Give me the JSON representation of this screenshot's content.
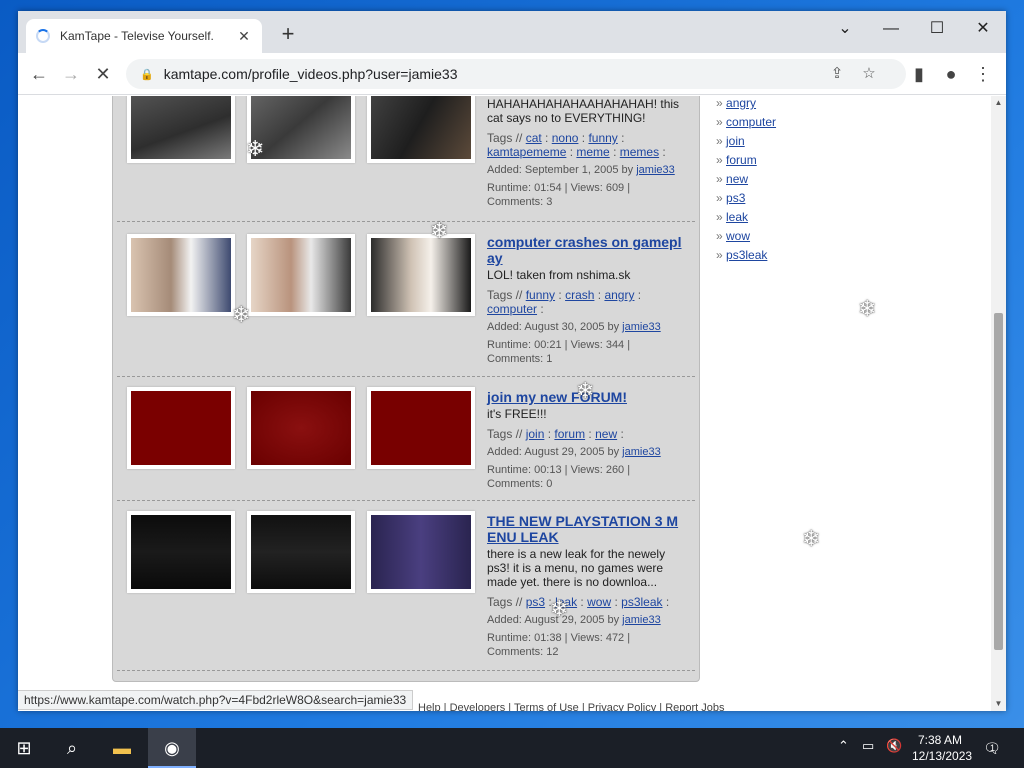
{
  "browser": {
    "tab_title": "KamTape - Televise Yourself.",
    "url": "kamtape.com/profile_videos.php?user=jamie33",
    "status_url": "https://www.kamtape.com/watch.php?v=4Fbd2rleW8O&search=jamie33"
  },
  "videos": [
    {
      "title": "",
      "desc": "HAHAHAHAHAHAAHAHAHAH! this cat says no to EVERYTHING!",
      "tags_label": "Tags //",
      "tags": [
        "cat",
        "nono",
        "funny",
        "kamtapememe",
        "meme",
        "memes"
      ],
      "added": "Added: September 1, 2005 by",
      "user": "jamie33",
      "stats": "Runtime: 01:54 | Views: 609 | Comments: 3"
    },
    {
      "title": "computer crashes on gameplay",
      "desc": "LOL! taken from nshima.sk",
      "tags_label": "Tags //",
      "tags": [
        "funny",
        "crash",
        "angry",
        "computer"
      ],
      "added": "Added: August 30, 2005 by",
      "user": "jamie33",
      "stats": "Runtime: 00:21 | Views: 344 | Comments: 1"
    },
    {
      "title": "join my new FORUM!",
      "desc": "it's FREE!!!",
      "tags_label": "Tags //",
      "tags": [
        "join",
        "forum",
        "new"
      ],
      "added": "Added: August 29, 2005 by",
      "user": "jamie33",
      "stats": "Runtime: 00:13 | Views: 260 | Comments: 0"
    },
    {
      "title": "THE NEW PLAYSTATION 3 MENU LEAK",
      "desc": "there is a new leak for the newely ps3! it is a menu, no games were made yet. there is no downloa...",
      "tags_label": "Tags //",
      "tags": [
        "ps3",
        "leak",
        "wow",
        "ps3leak"
      ],
      "added": "Added: August 29, 2005 by",
      "user": "jamie33",
      "stats": "Runtime: 01:38 | Views: 472 | Comments: 12"
    }
  ],
  "side_tags": [
    "angry",
    "computer",
    "join",
    "forum",
    "new",
    "ps3",
    "leak",
    "wow",
    "ps3leak"
  ],
  "footer": "Help | Developers | Terms of Use | Privacy Policy | Report Jobs",
  "taskbar": {
    "time": "7:38 AM",
    "date": "12/13/2023",
    "notif_count": "1"
  },
  "colors": {
    "panel_bg": "#d8d8d8",
    "link": "#1e46a0",
    "thumb_dark_red": "#7a0000"
  }
}
